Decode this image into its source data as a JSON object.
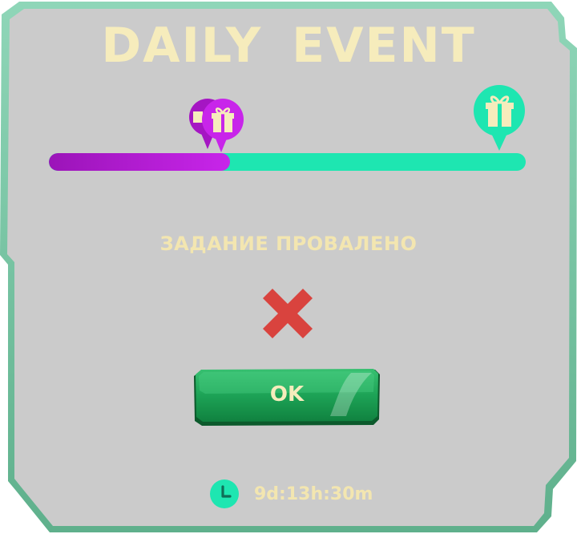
{
  "header": {
    "title": "DAILY  EVENT"
  },
  "progress": {
    "fraction": 0.38,
    "fill_color_start": "#9b14b8",
    "fill_color_end": "#c825ea",
    "track_color": "#1ee6b1",
    "markers": [
      {
        "icon": "gift-icon",
        "color": "#c825ea",
        "state": "current"
      },
      {
        "icon": "gift-icon",
        "color": "#1ee6b1",
        "state": "final-reward"
      }
    ]
  },
  "status": {
    "text": "ЗАДАНИЕ ПРОВАЛЕНО",
    "icon": "fail-cross-icon",
    "icon_color": "#d9433e"
  },
  "ok_button": {
    "label": "OK",
    "color": "#1b9a4e"
  },
  "timer": {
    "icon": "clock-icon",
    "text": "9d:13h:30m"
  },
  "colors": {
    "panel": "#cbcbcb",
    "border": "#6fc4a0",
    "text_cream": "#f6ecbc"
  }
}
